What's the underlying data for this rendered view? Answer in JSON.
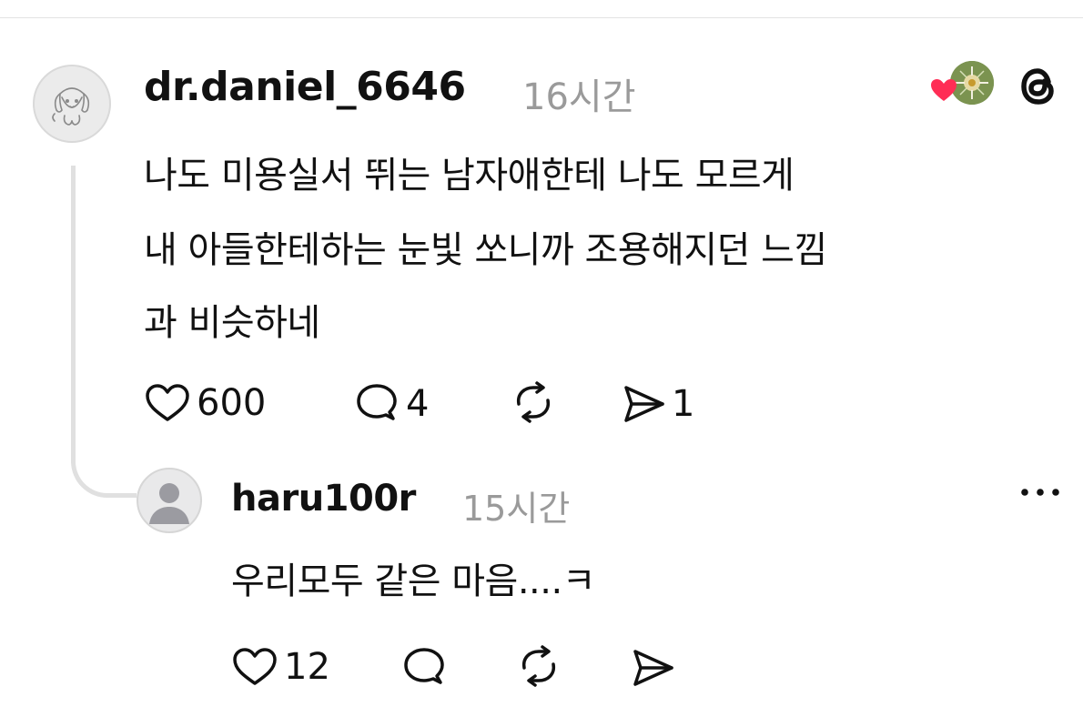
{
  "colors": {
    "text": "#111111",
    "muted": "#9a9a9a",
    "divider": "#e3e3e3",
    "thread_line": "#e0e0e0",
    "heart_red": "#ff2d55",
    "badge_green": "#6f8a48"
  },
  "icons": {
    "threads_logo": "threads-logo-icon",
    "heart_badge": "heart-icon",
    "like": "heart-outline-icon",
    "reply": "speech-bubble-icon",
    "repost": "repost-icon",
    "share": "send-icon",
    "more": "ellipsis-icon",
    "default_avatar": "person-silhouette-icon",
    "dog_avatar": "dog-drawing-avatar"
  },
  "main_post": {
    "username": "dr.daniel_6646",
    "timestamp": "16시간",
    "lines": [
      "나도 미용실서 뛰는 남자애한테 나도 모르게",
      "내 아들한테하는 눈빛 쏘니까 조용해지던 느낌",
      "과 비슷하네"
    ],
    "likes": "600",
    "replies": "4",
    "shares": "1"
  },
  "reply": {
    "username": "haru100r",
    "timestamp": "15시간",
    "text": "우리모두 같은 마음....ㅋ",
    "likes": "12"
  }
}
